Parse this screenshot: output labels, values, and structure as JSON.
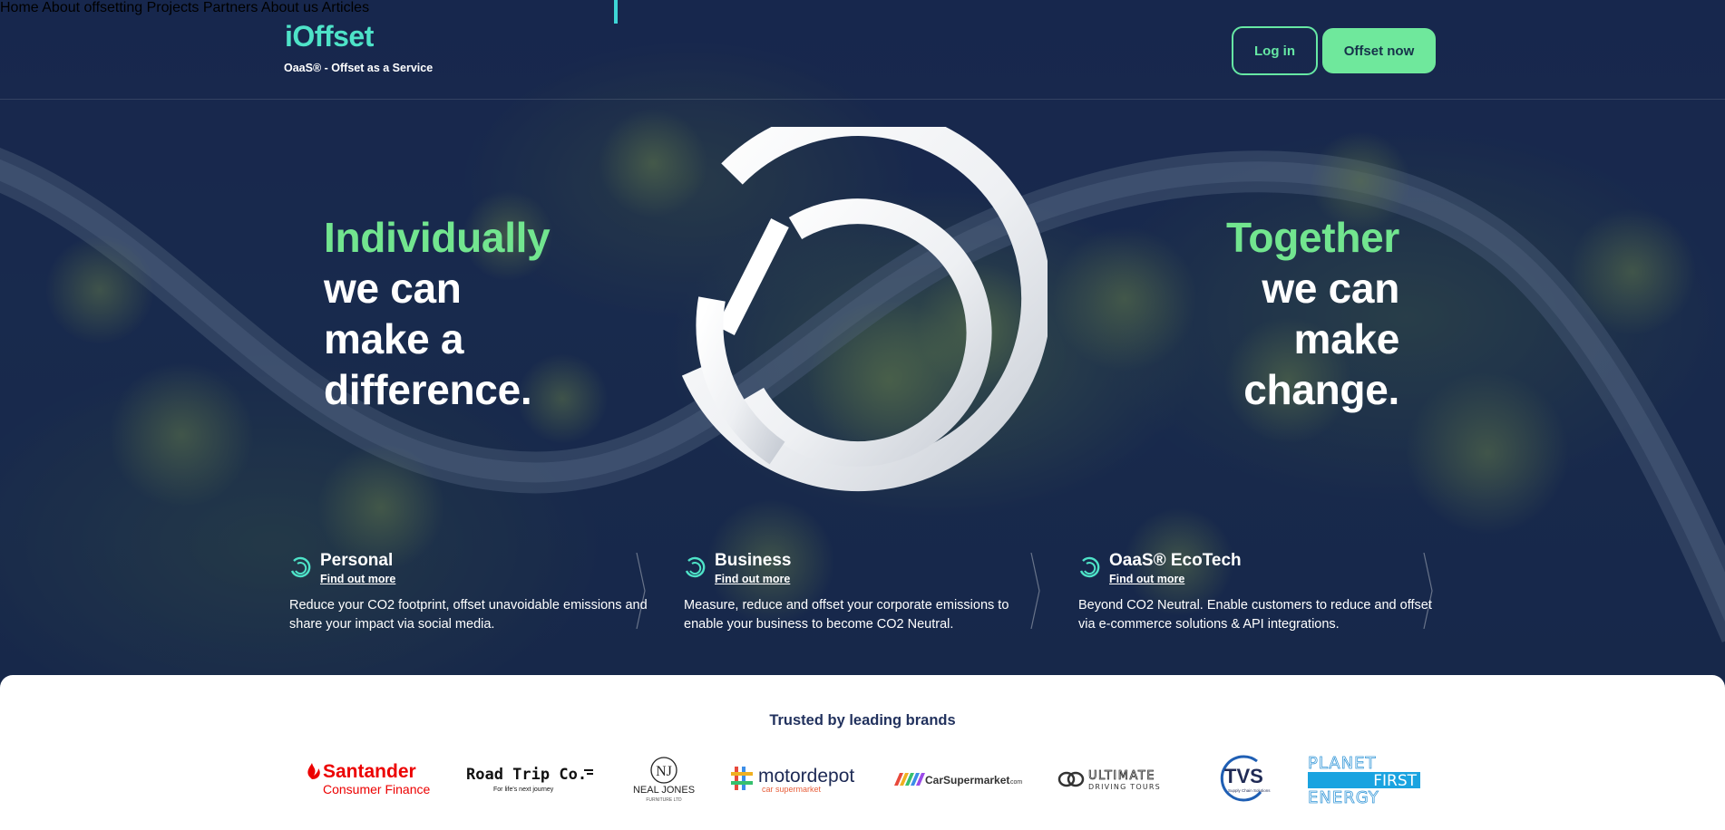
{
  "header": {
    "logo": "iOffset",
    "tagline": "OaaS® - Offset as a Service",
    "nav": [
      "Home",
      "About offsetting",
      "Projects",
      "Partners",
      "About us",
      "Articles"
    ],
    "active_nav": "Home",
    "login_label": "Log in",
    "cta_label": "Offset now"
  },
  "hero": {
    "left": {
      "accent": "Individually",
      "lines": [
        "we can",
        "make a",
        "difference."
      ]
    },
    "right": {
      "accent": "Together",
      "lines": [
        "we can",
        "make",
        "change."
      ]
    }
  },
  "features": [
    {
      "title": "Personal",
      "link": "Find out more",
      "description": "Reduce your CO2 footprint, offset unavoidable emissions and share your impact via social media."
    },
    {
      "title": "Business",
      "link": "Find out more",
      "description": "Measure, reduce and offset your corporate emissions to enable your business to become CO2 Neutral."
    },
    {
      "title": "OaaS® EcoTech",
      "link": "Find out more",
      "description": "Beyond CO2 Neutral. Enable customers to reduce and offset via e-commerce solutions & API integrations."
    }
  ],
  "brands": {
    "title": "Trusted by leading brands",
    "logos": [
      {
        "name": "Santander",
        "sub": "Consumer Finance"
      },
      {
        "name": "Road Trip Co.",
        "sub": "For life's next journey"
      },
      {
        "name": "NJ",
        "sub": "NEAL JONES",
        "sub2": "FURNITURE LTD"
      },
      {
        "name": "motordepot",
        "sub": "car supermarket"
      },
      {
        "name": "CarSupermarket",
        "sub": ".com"
      },
      {
        "name": "ULTIMATE",
        "sub": "DRIVING TOURS"
      },
      {
        "name": "TVS",
        "sub": "Supply Chain Solutions"
      },
      {
        "name": "PLANET",
        "mid": "FIRST",
        "sub": "ENERGY"
      }
    ]
  },
  "colors": {
    "logo": "#4ee3c8",
    "accent_green": "#72e58f",
    "button_green": "#6fe89c",
    "hero_bg": "#1b2a50",
    "brands_title": "#22325e",
    "santander_red": "#ec0000"
  }
}
